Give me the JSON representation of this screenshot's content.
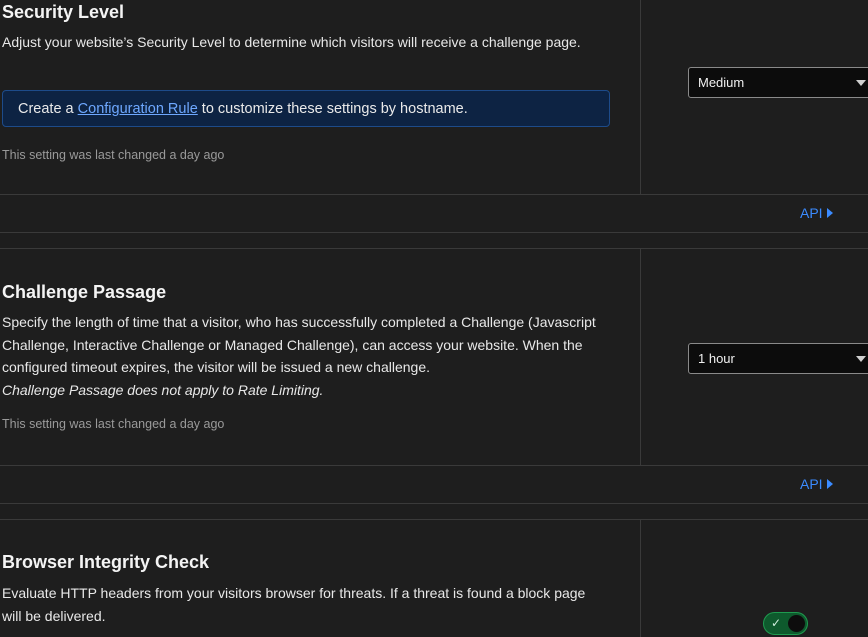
{
  "security_level": {
    "title": "Security Level",
    "description": "Adjust your website’s Security Level to determine which visitors will receive a challenge page.",
    "notice_prefix": "Create a",
    "notice_link": "Configuration Rule",
    "notice_suffix": "to customize these settings by hostname.",
    "last_changed": "This setting was last changed a day ago",
    "selected": "Medium",
    "api_label": "API"
  },
  "challenge_passage": {
    "title": "Challenge Passage",
    "description": "Specify the length of time that a visitor, who has successfully completed a Challenge (Javascript Challenge, Interactive Challenge or Managed Challenge), can access your website. When the configured timeout expires, the visitor will be issued a new challenge.",
    "note": "Challenge Passage does not apply to Rate Limiting.",
    "last_changed": "This setting was last changed a day ago",
    "selected": "1 hour",
    "api_label": "API"
  },
  "browser_integrity": {
    "title": "Browser Integrity Check",
    "description": "Evaluate HTTP headers from your visitors browser for threats. If a threat is found a block page will be delivered.",
    "enabled": true,
    "toggle_icon": "check-icon"
  },
  "colors": {
    "background": "#1e1e1e",
    "link": "#6ea8ff",
    "api": "#3b8bff",
    "notice_bg": "#0d2343",
    "toggle_on": "#0e5a2d"
  }
}
